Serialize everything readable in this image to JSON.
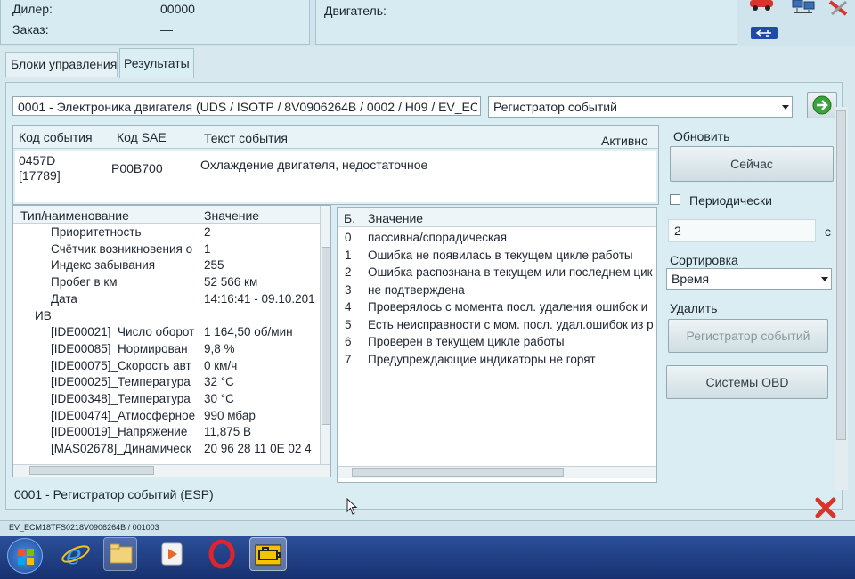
{
  "header": {
    "dealer_label": "Дилер:",
    "dealer_value": "00000",
    "order_label": "Заказ:",
    "order_value": "—",
    "engine_label": "Двигатель:",
    "engine_value": "—"
  },
  "tabs": [
    {
      "label": "Блоки управления"
    },
    {
      "label": "Результаты"
    }
  ],
  "unit_selector": {
    "value": "0001 - Электроника двигателя  (UDS / ISOTP / 8V0906264B  / 0002 / H09 / EV_EC"
  },
  "mode_selector": {
    "value": "Регистратор событий"
  },
  "event_table": {
    "columns": {
      "code": "Код события",
      "sae": "Код SAE",
      "text": "Текст события",
      "active": "Активно"
    },
    "row": {
      "code_line1": "0457D",
      "code_line2": "[17789]",
      "sae": "P00B700",
      "text": "Охлаждение двигателя, недостаточное"
    }
  },
  "details": {
    "col_name": "Тип/наименование",
    "col_value": "Значение",
    "rows": [
      {
        "name": "Приоритетность",
        "value": "2"
      },
      {
        "name": "Счётчик возникновения о",
        "value": "1"
      },
      {
        "name": "Индекс забывания",
        "value": "255"
      },
      {
        "name": "Пробег в км",
        "value": "52 566 км"
      },
      {
        "name": "Дата",
        "value": "14:16:41 - 09.10.201"
      },
      {
        "name": "ИВ",
        "value": ""
      },
      {
        "name": "[IDE00021]_Число оборот",
        "value": "1 164,50 об/мин"
      },
      {
        "name": "[IDE00085]_Нормирован",
        "value": "9,8 %"
      },
      {
        "name": "[IDE00075]_Скорость авт",
        "value": "0 км/ч"
      },
      {
        "name": "[IDE00025]_Температура",
        "value": "32 °C"
      },
      {
        "name": "[IDE00348]_Температура",
        "value": "30 °C"
      },
      {
        "name": "[IDE00474]_Атмосферное",
        "value": "990 мбар"
      },
      {
        "name": "[IDE00019]_Напряжение",
        "value": "11,875 В"
      },
      {
        "name": "[MAS02678]_Динамическ",
        "value": "20 96 28 11 0E 02 4"
      }
    ]
  },
  "status_bits": {
    "col_bit": "Б.",
    "col_value": "Значение",
    "rows": [
      {
        "bit": "0",
        "value": "пассивна/спорадическая"
      },
      {
        "bit": "1",
        "value": "Ошибка не появилась в текущем цикле работы"
      },
      {
        "bit": "2",
        "value": "Ошибка распознана в текущем или последнем цик"
      },
      {
        "bit": "3",
        "value": "не подтверждена"
      },
      {
        "bit": "4",
        "value": "Проверялось с момента посл. удаления ошибок и"
      },
      {
        "bit": "5",
        "value": "Есть неисправности с мом. посл. удал.ошибок из р"
      },
      {
        "bit": "6",
        "value": "Проверен в текущем цикле работы"
      },
      {
        "bit": "7",
        "value": "Предупреждающие индикаторы не горят"
      }
    ]
  },
  "side": {
    "refresh_label": "Обновить",
    "now_button": "Сейчас",
    "periodic_label": "Периодически",
    "interval_value": "2",
    "interval_unit": "с",
    "sort_label": "Сортировка",
    "sort_value": "Время",
    "delete_label": "Удалить",
    "delete_button": "Регистратор событий",
    "obd_button": "Системы OBD"
  },
  "status_message": "0001 - Регистратор событий (ESP)",
  "footer_path": "EV_ECM18TFS0218V0906264B / 001003",
  "colors": {
    "background": "#d7e8ee",
    "taskbar": "#1e3f86",
    "close_red": "#d9342b",
    "go_green": "#3aa33a"
  }
}
